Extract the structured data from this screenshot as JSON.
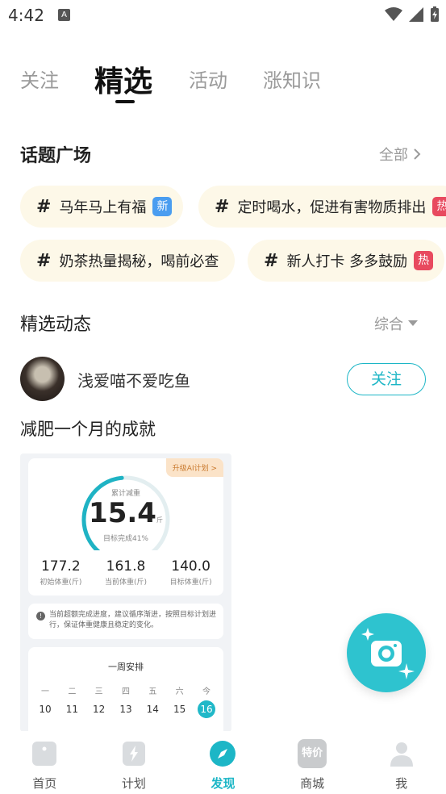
{
  "status_bar": {
    "time": "4:42",
    "a_label": "A"
  },
  "top_tabs": [
    {
      "label": "关注"
    },
    {
      "label": "精选"
    },
    {
      "label": "活动"
    },
    {
      "label": "涨知识"
    }
  ],
  "topics": {
    "title": "话题广场",
    "more_label": "全部",
    "chips": [
      {
        "hash": "#",
        "label": "马年马上有福",
        "badge": "新"
      },
      {
        "hash": "#",
        "label": "定时喝水，促进有害物质排出",
        "badge": "热"
      },
      {
        "hash": "#",
        "label": "奶茶热量揭秘，喝前必查",
        "badge": ""
      },
      {
        "hash": "#",
        "label": "新人打卡 多多鼓励",
        "badge": "热"
      }
    ]
  },
  "featured": {
    "title": "精选动态",
    "sort_label": "综合"
  },
  "post": {
    "username": "浅爱喵不爱吃鱼",
    "follow_label": "关注",
    "title": "减肥一个月的成就",
    "image": {
      "upgrade_label": "升级AI计划 >",
      "ring_caption": "累计减重",
      "ring_value": "15.4",
      "ring_unit": "斤",
      "ring_sub": "目标完成41%",
      "progress_fraction": 0.41,
      "stats": [
        {
          "value": "177.2",
          "label": "初始体重(斤)"
        },
        {
          "value": "161.8",
          "label": "当前体重(斤)"
        },
        {
          "value": "140.0",
          "label": "目标体重(斤)"
        }
      ],
      "info_text": "当前超额完成进度，建议循序渐进，按照目标计划进行，保证体重健康且稳定的变化。",
      "week_title": "一周安排",
      "weekdays": [
        "一",
        "二",
        "三",
        "四",
        "五",
        "六",
        "今"
      ],
      "dates": [
        "10",
        "11",
        "12",
        "13",
        "14",
        "15",
        "16"
      ]
    }
  },
  "bottom_nav": [
    {
      "label": "首页"
    },
    {
      "label": "计划"
    },
    {
      "label": "发现"
    },
    {
      "label": "商城",
      "icon_text": "特价"
    },
    {
      "label": "我"
    }
  ],
  "colors": {
    "accent": "#1cb6c6",
    "chip_bg": "#fdf8e8",
    "badge_new": "#4a9df0",
    "badge_hot": "#e84a5f"
  }
}
